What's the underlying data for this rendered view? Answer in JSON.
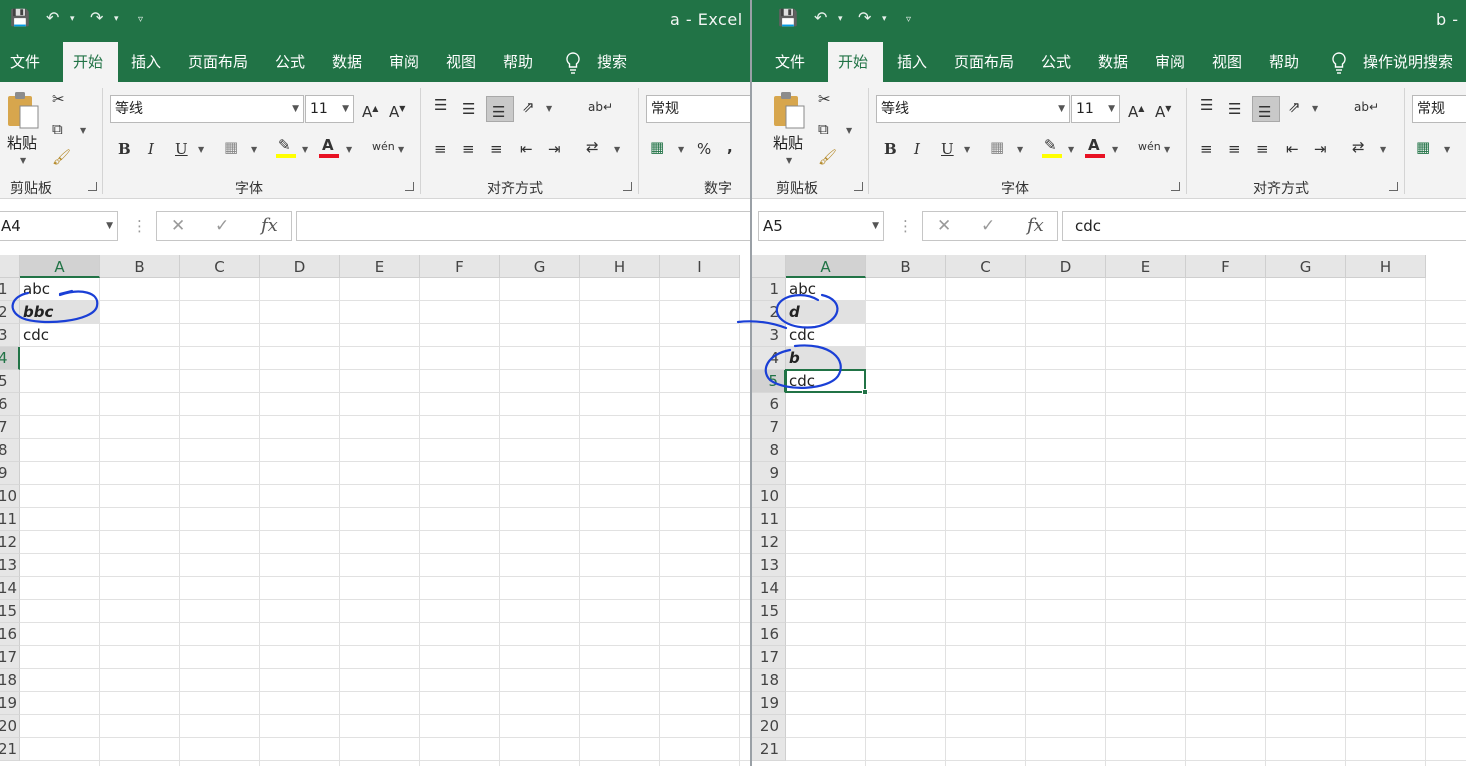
{
  "windows": [
    {
      "id": "a",
      "title": "a  -  Excel",
      "tabs": [
        "文件",
        "开始",
        "插入",
        "页面布局",
        "公式",
        "数据",
        "审阅",
        "视图",
        "帮助"
      ],
      "active_tab": "开始",
      "search_label": "搜索",
      "font_name": "等线",
      "font_size": "11",
      "number_format": "常规",
      "groups": [
        "剪贴板",
        "字体",
        "对齐方式",
        "数字"
      ],
      "paste_label": "粘贴",
      "name_box": "A4",
      "formula": "",
      "columns": [
        "A",
        "B",
        "C",
        "D",
        "E",
        "F",
        "G",
        "H",
        "I"
      ],
      "rows": [
        "1",
        "2",
        "3",
        "4",
        "5",
        "6",
        "7",
        "8",
        "9",
        "10",
        "11",
        "12",
        "13",
        "14",
        "15",
        "16",
        "17",
        "18",
        "19",
        "20",
        "21"
      ],
      "cells": [
        {
          "ref": "A1",
          "value": "abc",
          "style": "normal"
        },
        {
          "ref": "A2",
          "value": "bbc",
          "style": "bold-italic-shaded"
        },
        {
          "ref": "A3",
          "value": "cdc",
          "style": "normal"
        }
      ]
    },
    {
      "id": "b",
      "title": "b  -",
      "tabs": [
        "文件",
        "开始",
        "插入",
        "页面布局",
        "公式",
        "数据",
        "审阅",
        "视图",
        "帮助"
      ],
      "active_tab": "开始",
      "search_label": "操作说明搜索",
      "font_name": "等线",
      "font_size": "11",
      "number_format": "常规",
      "groups": [
        "剪贴板",
        "字体",
        "对齐方式"
      ],
      "paste_label": "粘贴",
      "name_box": "A5",
      "formula": "cdc",
      "columns": [
        "A",
        "B",
        "C",
        "D",
        "E",
        "F",
        "G",
        "H"
      ],
      "rows": [
        "1",
        "2",
        "3",
        "4",
        "5",
        "6",
        "7",
        "8",
        "9",
        "10",
        "11",
        "12",
        "13",
        "14",
        "15",
        "16",
        "17",
        "18",
        "19",
        "20",
        "21"
      ],
      "cells": [
        {
          "ref": "A1",
          "value": "abc",
          "style": "normal"
        },
        {
          "ref": "A2",
          "value": "d",
          "style": "bold-italic-shaded"
        },
        {
          "ref": "A3",
          "value": "cdc",
          "style": "normal"
        },
        {
          "ref": "A4",
          "value": "b",
          "style": "bold-italic-shaded"
        },
        {
          "ref": "A5",
          "value": "cdc",
          "style": "normal"
        }
      ],
      "selected_cell": "A5"
    }
  ],
  "colors": {
    "excel_green": "#217346",
    "ribbon_bg": "#f3f3f3",
    "ink_annotation": "#1a3fd6",
    "font_color_swatch": "#e81123",
    "highlight_swatch": "#ffff00"
  }
}
